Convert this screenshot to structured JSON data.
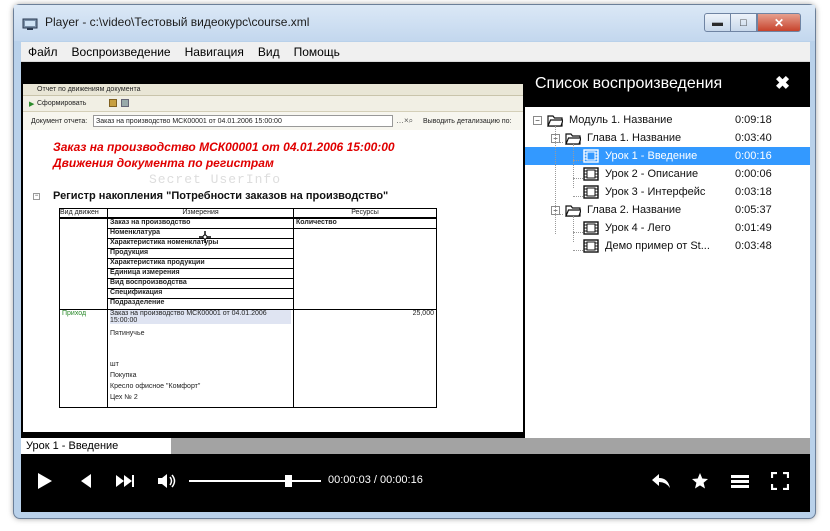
{
  "window": {
    "title": "Player - c:\\video\\Тестовый видеокурс\\course.xml",
    "min_icon": "minimize-icon",
    "max_icon": "maximize-icon",
    "close_icon": "close-icon"
  },
  "menu": [
    "Файл",
    "Воспроизведение",
    "Навигация",
    "Вид",
    "Помощь"
  ],
  "video": {
    "doc_tab": "Отчет по движениям документа",
    "toolbar_button": "Сформировать",
    "report_label": "Документ отчета:",
    "report_value": "Заказ на производство МСК00001 от 04.01.2006 15:00:00",
    "detail_label": "Выводить детализацию по:",
    "heading_1": "Заказ на производство МСК00001 от 04.01.2006 15:00:00",
    "heading_2": "Движения документа по регистрам",
    "watermark": "Secret UserInfo",
    "register_title": "Регистр накопления \"Потребности заказов на производство\"",
    "col_kind": "Вид движен",
    "col_dims": "Измерения",
    "col_res": "Ресурсы",
    "res_qty": "Количество",
    "dims": [
      "Заказ на производство",
      "Номенклатура",
      "Характеристика номенклатуры",
      "Продукция",
      "Характеристика продукции",
      "Единица измерения",
      "Вид воспроизводства",
      "Спецификация",
      "Подразделение"
    ],
    "row_kind": "Приход",
    "row_dim_1": "Заказ на производство МСК00001 от 04.01.2006 15:00:00",
    "row_dim_2": "Пятинучье",
    "row_dim_3": "шт",
    "row_dim_4": "Покупка",
    "row_dim_5": "Кресло офисное \"Комфорт\"",
    "row_dim_6": "Цех № 2",
    "row_qty": "25,000"
  },
  "playlist": {
    "title": "Список воспроизведения",
    "items": [
      {
        "label": "Модуль 1. Название",
        "time": "0:09:18"
      },
      {
        "label": "Глава 1. Название",
        "time": "0:03:40"
      },
      {
        "label": "Урок 1 - Введение",
        "time": "0:00:16"
      },
      {
        "label": "Урок 2 - Описание",
        "time": "0:00:06"
      },
      {
        "label": "Урок 3 - Интерфейс",
        "time": "0:03:18"
      },
      {
        "label": "Глава 2. Название",
        "time": "0:05:37"
      },
      {
        "label": "Урок 4 - Лего",
        "time": "0:01:49"
      },
      {
        "label": "Демо пример от St...",
        "time": "0:03:48"
      }
    ],
    "selected_index": 2
  },
  "status": {
    "current_lesson": "Урок 1 - Введение"
  },
  "controls": {
    "time": "00:00:03 / 00:00:16",
    "seek_progress": 0.75,
    "icons": [
      "play-icon",
      "previous-icon",
      "next-icon",
      "volume-icon",
      "back-icon",
      "favorite-icon",
      "playlist-icon",
      "fullscreen-icon"
    ]
  },
  "colors": {
    "selection": "#3399ff",
    "heading_red": "#e00000",
    "window_frame": "#b9d1ea"
  }
}
